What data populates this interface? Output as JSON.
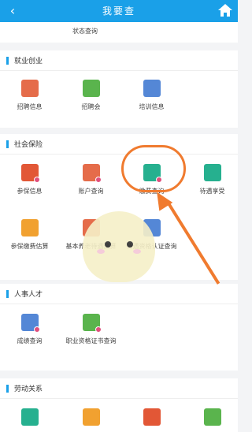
{
  "topbar": {
    "title": "我要查"
  },
  "partial": {
    "label": "状态查询"
  },
  "sections": [
    {
      "title": "就业创业",
      "items": [
        {
          "label": "招聘信息"
        },
        {
          "label": "招聘会"
        },
        {
          "label": "培训信息"
        }
      ]
    },
    {
      "title": "社会保险",
      "items": [
        {
          "label": "参保信息"
        },
        {
          "label": "账户查询"
        },
        {
          "label": "缴费查询"
        },
        {
          "label": "待遇享受"
        },
        {
          "label": "参保缴费估算"
        },
        {
          "label": "基本养老待遇测算"
        },
        {
          "label": "待遇资格认证查询"
        }
      ]
    },
    {
      "title": "人事人才",
      "items": [
        {
          "label": "成绩查询"
        },
        {
          "label": "职业资格证书查询"
        }
      ]
    },
    {
      "title": "劳动关系",
      "items": []
    }
  ],
  "colors": {
    "primary": "#1aa0e8",
    "annotation": "#f07b2f"
  }
}
